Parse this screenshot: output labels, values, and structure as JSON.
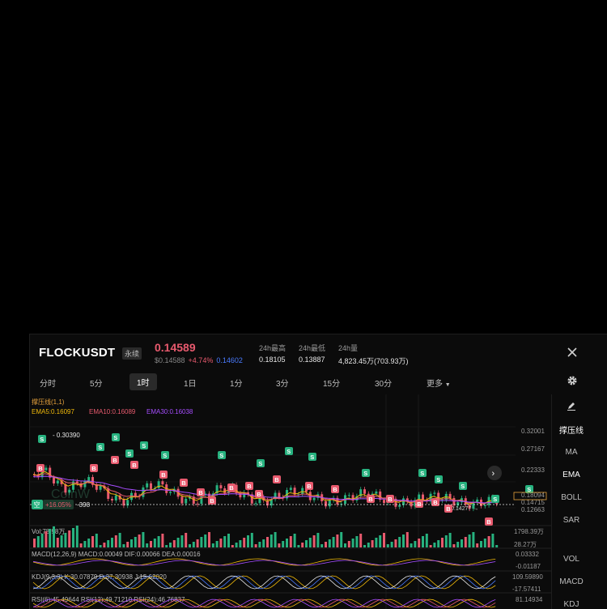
{
  "header": {
    "symbol": "FLOCKUSDT",
    "contract_type": "永续",
    "last_price": "0.14589",
    "usd_price": "$0.14588",
    "change_pct": "+4.74%",
    "mark_price": "0.14602",
    "stats": [
      {
        "label": "24h最高",
        "value": "0.18105"
      },
      {
        "label": "24h最低",
        "value": "0.13887"
      },
      {
        "label": "24h量",
        "value": "4,823.45万(703.93万)"
      }
    ]
  },
  "timeframes": [
    "分时",
    "5分",
    "1时",
    "1日",
    "1分",
    "3分",
    "15分",
    "30分",
    "更多"
  ],
  "active_timeframe": "1时",
  "side_tools": [
    "撑压线",
    "MA",
    "EMA",
    "BOLL",
    "SAR",
    "VOL",
    "MACD",
    "KDJ"
  ],
  "chart": {
    "overlay_title": "撑压线(1,1)",
    "ema_labels": [
      "EMA5:0.16097",
      "EMA10:0.16089",
      "EMA30:0.16038"
    ],
    "y_ticks": [
      "0.32001",
      "0.27167",
      "0.22333",
      "0.18094",
      "0.14715",
      "0.12663"
    ],
    "resistance_label": "0.30390",
    "low_label": "0.14277",
    "position": {
      "side": "空",
      "pnl": "+16.05%",
      "qty": "-398"
    },
    "vol_label": "Vol:78.98万",
    "vol_tick": "1798.39万",
    "vol_tick2": "28.27万",
    "macd_label": "MACD(12,26,9)  MACD:0.00049  DIF:0.00066  DEA:0.00016",
    "macd_ticks": [
      "0.03332",
      "-0.01187"
    ],
    "kdj_label": "KDJ(9,3,3)  K:30.07879  D:37.30938  J:15.62020",
    "kdj_ticks": [
      "109.59890",
      "-17.57411"
    ],
    "rsi_label": "RSI(6):45.49644  RSI(12):49.71210  RSI(24):46.76837",
    "rsi_tick": "81.14934",
    "watermark": "CoinW"
  },
  "colors": {
    "up": "#27b27f",
    "down": "#e85a6e",
    "ema5": "#f0b90b",
    "ema10": "#e85a6e",
    "ema30": "#a64dff"
  }
}
